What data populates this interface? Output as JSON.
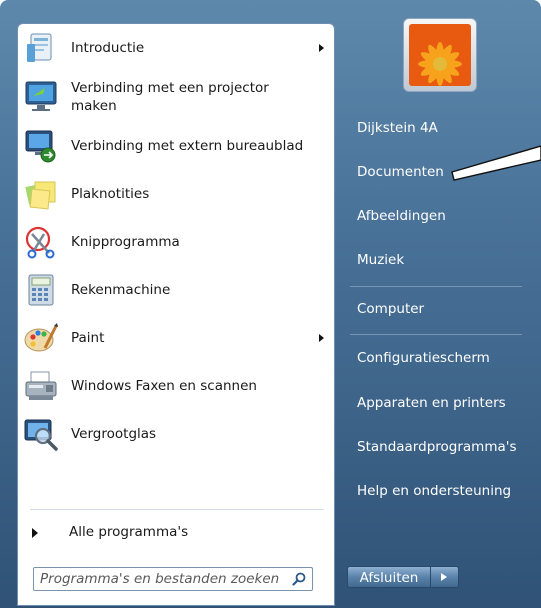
{
  "programs": [
    {
      "label": "Introductie",
      "icon": "getting-started-icon",
      "submenu": true
    },
    {
      "label": "Verbinding met een projector\nmaken",
      "icon": "projector-icon",
      "submenu": false
    },
    {
      "label": "Verbinding met extern bureaublad",
      "icon": "remote-desktop-icon",
      "submenu": false
    },
    {
      "label": "Plaknotities",
      "icon": "sticky-notes-icon",
      "submenu": false
    },
    {
      "label": "Knipprogramma",
      "icon": "scissors-icon",
      "submenu": false
    },
    {
      "label": "Rekenmachine",
      "icon": "calculator-icon",
      "submenu": false
    },
    {
      "label": "Paint",
      "icon": "paint-palette-icon",
      "submenu": true
    },
    {
      "label": "Windows Faxen en scannen",
      "icon": "fax-scanner-icon",
      "submenu": false
    },
    {
      "label": "Vergrootglas",
      "icon": "magnifier-icon",
      "submenu": false
    }
  ],
  "all_programs_label": "Alle programma's",
  "search": {
    "placeholder": "Programma's en bestanden zoeken"
  },
  "places": [
    {
      "label": "Dijkstein 4A"
    },
    {
      "label": "Documenten"
    },
    {
      "label": "Afbeeldingen"
    },
    {
      "label": "Muziek"
    },
    {
      "label": "Computer"
    },
    {
      "label": "Configuratiescherm"
    },
    {
      "label": "Apparaten en printers"
    },
    {
      "label": "Standaardprogramma's"
    },
    {
      "label": "Help en ondersteuning"
    }
  ],
  "shutdown": {
    "label": "Afsluiten"
  },
  "colors": {
    "menu_background": "#4a739a",
    "text_on_dark": "#ffffff"
  }
}
